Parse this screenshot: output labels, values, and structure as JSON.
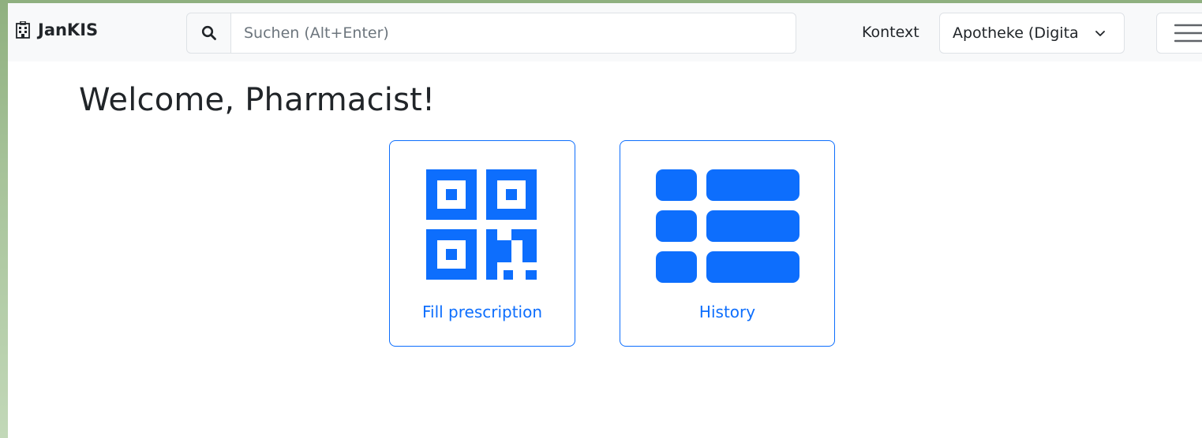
{
  "app": {
    "title": "JanKIS",
    "icon": "hospital-icon"
  },
  "search": {
    "placeholder": "Suchen (Alt+Enter)",
    "value": "",
    "icon": "search-icon"
  },
  "context": {
    "label": "Kontext",
    "selected": "Apotheke (Digita",
    "icon": "chevron-down-icon"
  },
  "menu": {
    "icon": "hamburger-menu-icon"
  },
  "main": {
    "heading": "Welcome, Pharmacist!",
    "tiles": [
      {
        "label": "Fill prescription",
        "icon": "qr-code-icon"
      },
      {
        "label": "History",
        "icon": "list-icon"
      }
    ]
  },
  "colors": {
    "accent": "#0d6efd",
    "navbar_bg": "#f8f9fa",
    "border": "#dee2e6",
    "text": "#212529"
  }
}
